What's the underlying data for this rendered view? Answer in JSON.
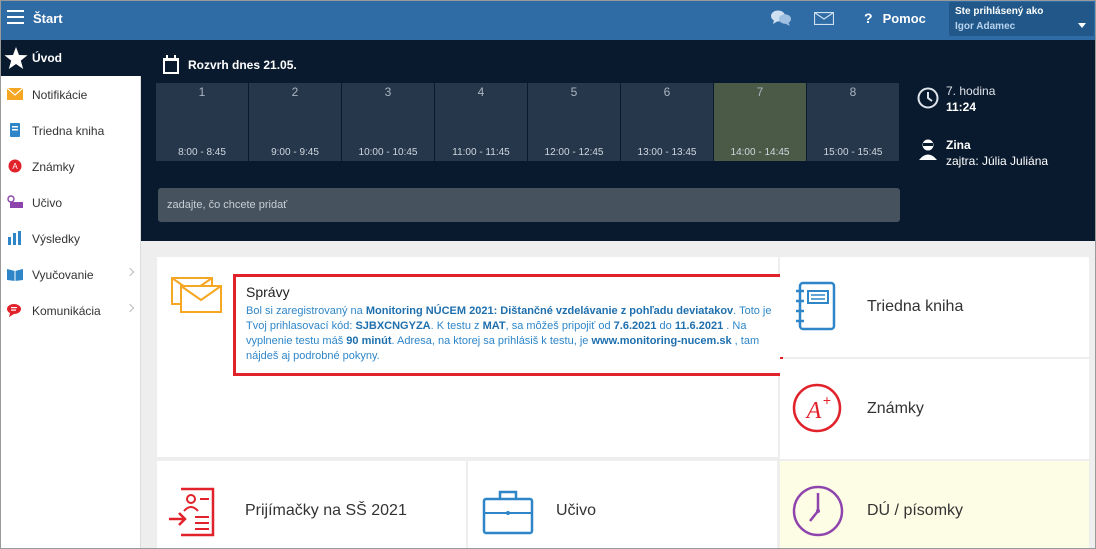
{
  "topbar": {
    "title": "Štart",
    "help_label": "Pomoc",
    "help_glyph": "?",
    "user_caption": "Ste prihlásený ako",
    "user_name": "Igor Adamec",
    "icons": [
      "menu-icon",
      "chat-icon",
      "mail-icon",
      "help-icon",
      "chevron-down-icon"
    ]
  },
  "sidebar": {
    "active": {
      "label": "Úvod",
      "icon": "star-icon"
    },
    "items": [
      {
        "label": "Notifikácie",
        "icon": "envelope-icon",
        "color": "#f5a623"
      },
      {
        "label": "Triedna kniha",
        "icon": "book-icon",
        "color": "#2e86c9"
      },
      {
        "label": "Známky",
        "icon": "grade-icon",
        "color": "#e1222a"
      },
      {
        "label": "Učivo",
        "icon": "screen-icon",
        "color": "#8e44ad"
      },
      {
        "label": "Výsledky",
        "icon": "bar-chart-icon",
        "color": "#2e86c9"
      },
      {
        "label": "Vyučovanie",
        "icon": "open-book-icon",
        "color": "#2e86c9"
      },
      {
        "label": "Komunikácia",
        "icon": "speech-icon",
        "color": "#e1222a"
      }
    ]
  },
  "schedule": {
    "title": "Rozvrh dnes 21.05.",
    "slots": [
      {
        "num": "1",
        "time": "8:00 - 8:45"
      },
      {
        "num": "2",
        "time": "9:00 - 9:45"
      },
      {
        "num": "3",
        "time": "10:00 - 10:45"
      },
      {
        "num": "4",
        "time": "11:00 - 11:45"
      },
      {
        "num": "5",
        "time": "12:00 - 12:45"
      },
      {
        "num": "6",
        "time": "13:00 - 13:45"
      },
      {
        "num": "7",
        "time": "14:00 - 14:45"
      },
      {
        "num": "8",
        "time": "15:00 - 15:45"
      }
    ],
    "current_slot": "7",
    "input_placeholder": "zadajte, čo chcete pridať"
  },
  "status": {
    "hour_label": "7. hodina",
    "hour_time": "11:24",
    "person_name": "Zina",
    "person_next": "zajtra: Júlia Juliána"
  },
  "messages": {
    "heading": "Správy",
    "p1": "Bol si zaregistrovaný na ",
    "b1": "Monitoring NÚCEM 2021: Dištančné vzdelávanie z pohľadu deviatakov",
    "p2": ". Toto je Tvoj prihlasovací kód: ",
    "b2": "SJBXCNGYZA",
    "p3": ". K testu z ",
    "b3": "MAT",
    "p4": ", sa môžeš pripojiť od ",
    "b4": "7.6.2021",
    "p5": " do ",
    "b5": "11.6.2021",
    "p6": " . Na vyplnenie testu máš ",
    "b6": "90 minút",
    "p7": ". Adresa, na ktorej sa prihlásiš k testu, je ",
    "b7": "www.monitoring-nucem.sk",
    "p8": " , tam nájdeš aj podrobné pokyny."
  },
  "tiles": {
    "triedna_kniha": "Triedna kniha",
    "znamky": "Známky",
    "du": "DÚ / písomky",
    "prijimacky": "Prijímačky na SŠ 2021",
    "ucivo": "Učivo"
  },
  "colors": {
    "topbar": "#2f6ba4",
    "dark": "#0a1a2e",
    "slot": "#26374b",
    "slot_current": "#4b5a47",
    "accent_blue": "#2e86c9",
    "highlight_red": "#e1222a",
    "orange": "#f5a623",
    "purple": "#8e44ad"
  }
}
